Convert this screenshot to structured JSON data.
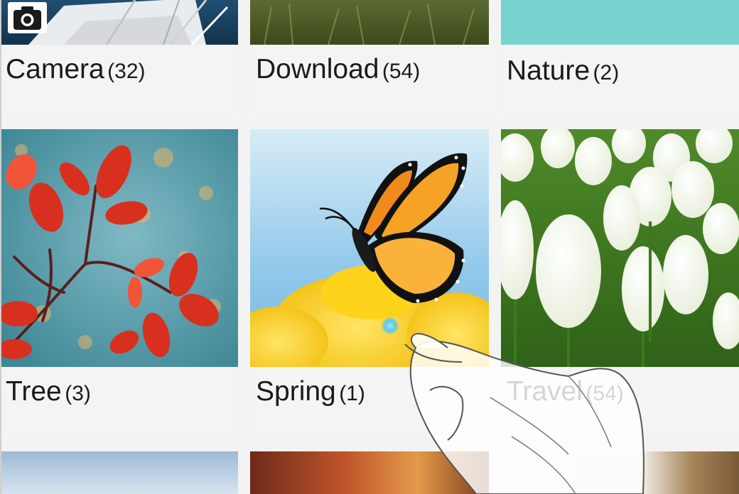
{
  "albums": [
    {
      "name": "Camera",
      "count": "(32)"
    },
    {
      "name": "Download",
      "count": "(54)"
    },
    {
      "name": "Nature",
      "count": "(2)"
    },
    {
      "name": "Tree",
      "count": "(3)"
    },
    {
      "name": "Spring",
      "count": "(1)"
    },
    {
      "name": "Travel",
      "count": "(54)"
    }
  ],
  "icons": {
    "camera_badge": "camera-icon"
  },
  "colors": {
    "background": "#f3f3f3",
    "caption_text": "#1a1a1a",
    "nature_thumb": "#77d4cf",
    "touch_indicator": "#5ac8ea"
  }
}
